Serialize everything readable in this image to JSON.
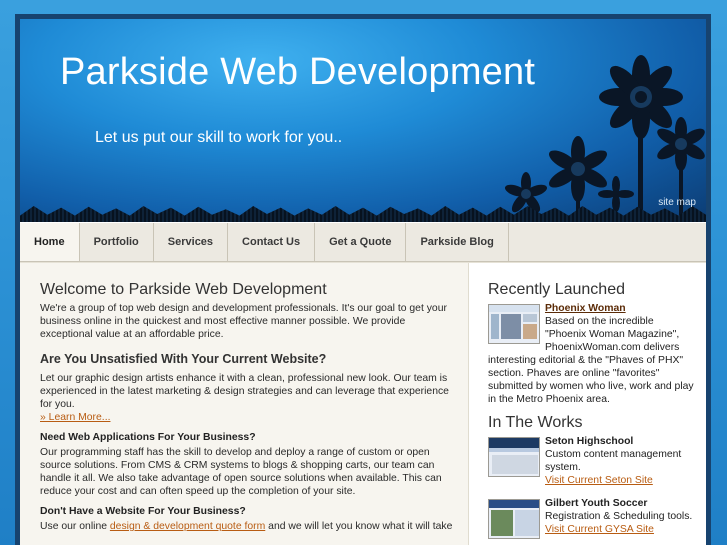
{
  "header": {
    "title": "Parkside Web Development",
    "tagline": "Let us put our skill to work for you..",
    "sitemap_label": "site map"
  },
  "nav": {
    "items": [
      {
        "label": "Home",
        "active": true
      },
      {
        "label": "Portfolio"
      },
      {
        "label": "Services"
      },
      {
        "label": "Contact Us"
      },
      {
        "label": "Get a Quote"
      },
      {
        "label": "Parkside Blog"
      }
    ]
  },
  "main": {
    "welcome_heading": "Welcome to Parkside Web Development",
    "welcome_text": "We're a group of top web design and development professionals. It's our goal to get your business online in the quickest and most effective manner possible. We provide exceptional value at an affordable price.",
    "unsatisfied_heading": "Are You Unsatisfied With Your Current Website?",
    "unsatisfied_text": "Let our graphic design artists enhance it with a clean, professional new look. Our team is experienced in the latest marketing & design strategies and can leverage that experience for you.",
    "learn_more": "» Learn More...",
    "apps_heading": "Need Web Applications For Your Business?",
    "apps_text": "Our programming staff has the skill to develop and deploy a range of custom or open source solutions. From CMS & CRM systems to blogs & shopping carts, our team can handle it all. We also take advantage of open source solutions when available. This can reduce your cost and can often speed up the completion of your site.",
    "nowebsite_heading": "Don't Have a Website For Your Business?",
    "nowebsite_text_before": "Use our online ",
    "nowebsite_link": "design & development quote form",
    "nowebsite_text_after": " and we will let you know what it will take"
  },
  "sidebar": {
    "recent_heading": "Recently Launched",
    "recent": {
      "name": "Phoenix Woman",
      "text": "Based on the incredible \"Phoenix Woman Magazine\", PhoenixWoman.com delivers interesting editorial & the \"Phaves of PHX\" section. Phaves are online \"favorites\" submitted by women who live, work and play in the Metro Phoenix area."
    },
    "works_heading": "In The Works",
    "works": [
      {
        "name": "Seton Highschool",
        "text": "Custom content management system.",
        "link": "Visit Current Seton Site"
      },
      {
        "name": "Gilbert Youth Soccer",
        "text": "Registration & Scheduling tools.",
        "link": "Visit Current GYSA Site"
      }
    ]
  },
  "colors": {
    "frame": "#17436f",
    "link": "#b85c12",
    "nav_bg": "#ece9e1",
    "main_bg": "#f7f5ef"
  }
}
